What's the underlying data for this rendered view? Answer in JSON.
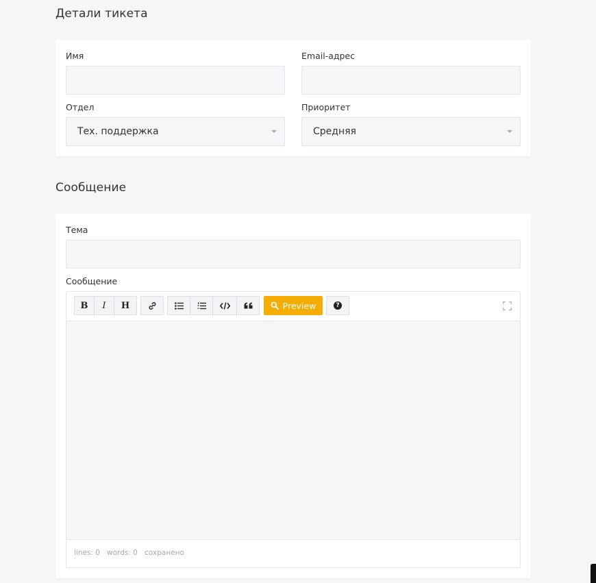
{
  "ticket_details": {
    "title": "Детали тикета",
    "name_label": "Имя",
    "name_value": "",
    "email_label": "Email-адрес",
    "email_value": "",
    "department_label": "Отдел",
    "department_value": "Тех. поддержка",
    "priority_label": "Приоритет",
    "priority_value": "Средняя"
  },
  "message": {
    "title": "Сообщение",
    "subject_label": "Тема",
    "subject_value": "",
    "message_label": "Сообщение",
    "message_value": ""
  },
  "editor": {
    "toolbar": {
      "bold": "B",
      "italic": "I",
      "heading": "H",
      "preview_label": "Preview",
      "accent_color": "#f6ad01"
    },
    "status": {
      "lines": "lines: 0",
      "words": "words: 0",
      "saved": "сохранено"
    }
  }
}
